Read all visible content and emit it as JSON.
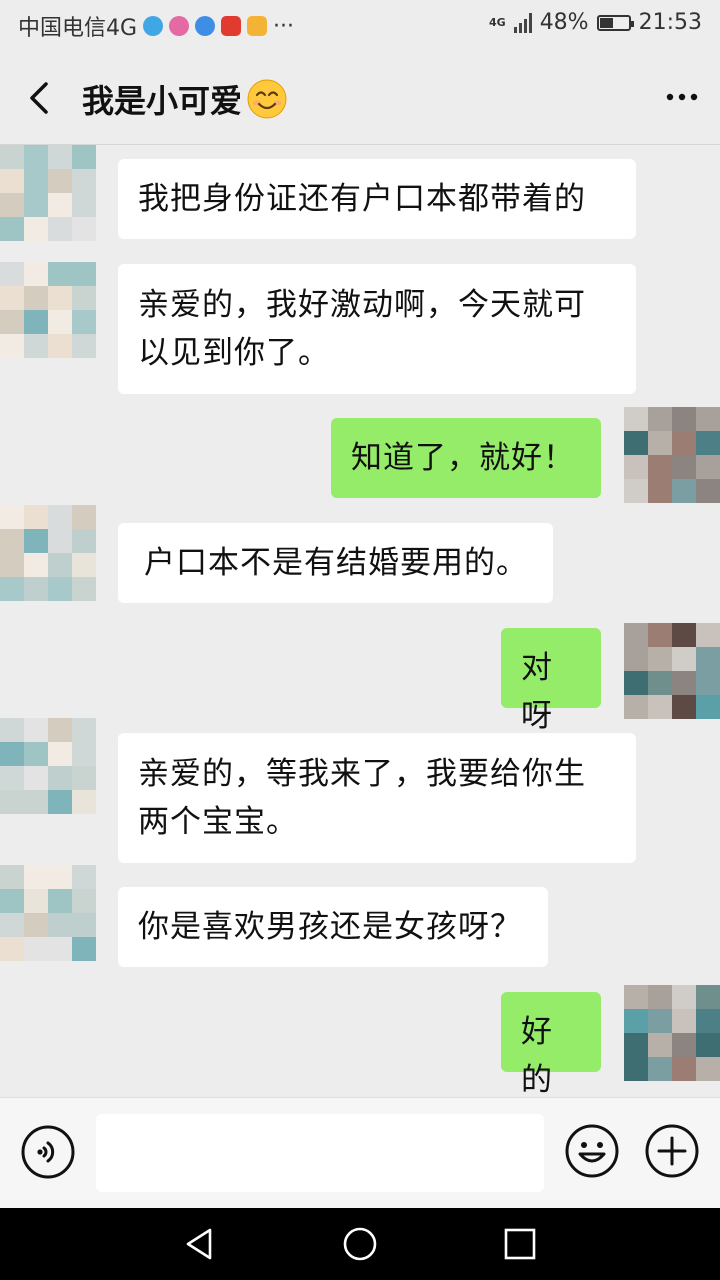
{
  "status_bar": {
    "carrier": "中国电信4G",
    "network_badge": "4G",
    "battery": "48%",
    "battery_level": 0.48,
    "time": "21:53",
    "more_dots": "···",
    "notification_icons": [
      "browser-icon",
      "message-app-icon",
      "browser-icon",
      "news-app-icon",
      "video-app-icon"
    ]
  },
  "header": {
    "title": "我是小可爱",
    "title_emoji": "smiling-face-emoji",
    "back_icon": "chevron-left-icon",
    "menu_icon": "more-horizontal-icon"
  },
  "messages": [
    {
      "side": "left",
      "text": "我把身份证还有户口本都带着的"
    },
    {
      "side": "left",
      "text": "亲爱的，我好激动啊，今天就可\n以见到你了。"
    },
    {
      "side": "right",
      "text": "知道了，就好！"
    },
    {
      "side": "left",
      "text": "户口本不是有结婚要用的。"
    },
    {
      "side": "right",
      "text": "对呀"
    },
    {
      "side": "left",
      "text": "亲爱的，等我来了，我要给你生\n两个宝宝。"
    },
    {
      "side": "left",
      "text": "你是喜欢男孩还是女孩呀？"
    },
    {
      "side": "right",
      "text": "好的"
    }
  ],
  "input_bar": {
    "input_value": "",
    "voice_icon": "voice-icon",
    "emoji_icon": "emoji-icon",
    "plus_icon": "plus-icon"
  },
  "nav_bar": {
    "back_icon": "triangle-back-icon",
    "home_icon": "circle-home-icon",
    "recents_icon": "square-recents-icon"
  },
  "colors": {
    "background": "#ededed",
    "bubble_left": "#ffffff",
    "bubble_right": "#95ec69",
    "nav_bar": "#000000"
  }
}
